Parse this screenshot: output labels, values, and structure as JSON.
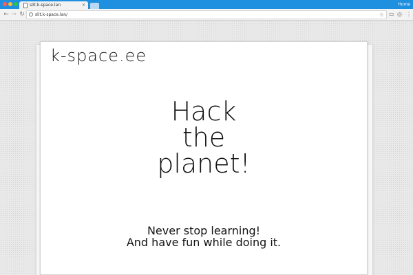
{
  "browser": {
    "tab": {
      "title": "slit.k-space.lan",
      "close": "✕"
    },
    "profile_name": "Home",
    "address_bar": {
      "url": "slit.k-space.lan/"
    },
    "icons": {
      "back": "back-arrow-icon",
      "forward": "forward-arrow-icon",
      "reload": "reload-icon",
      "star": "star-icon",
      "cast": "cast-icon",
      "opera": "opera-icon",
      "menu": "menu-icon"
    },
    "colors": {
      "titlebar": "#1f8fe0",
      "toolbar": "#f2f2f2"
    }
  },
  "slide": {
    "brand": "k-space.ee",
    "headline_lines": [
      "Hack",
      "the",
      "planet!"
    ],
    "tagline_lines": [
      "Never stop learning!",
      "And have fun while doing it."
    ]
  }
}
